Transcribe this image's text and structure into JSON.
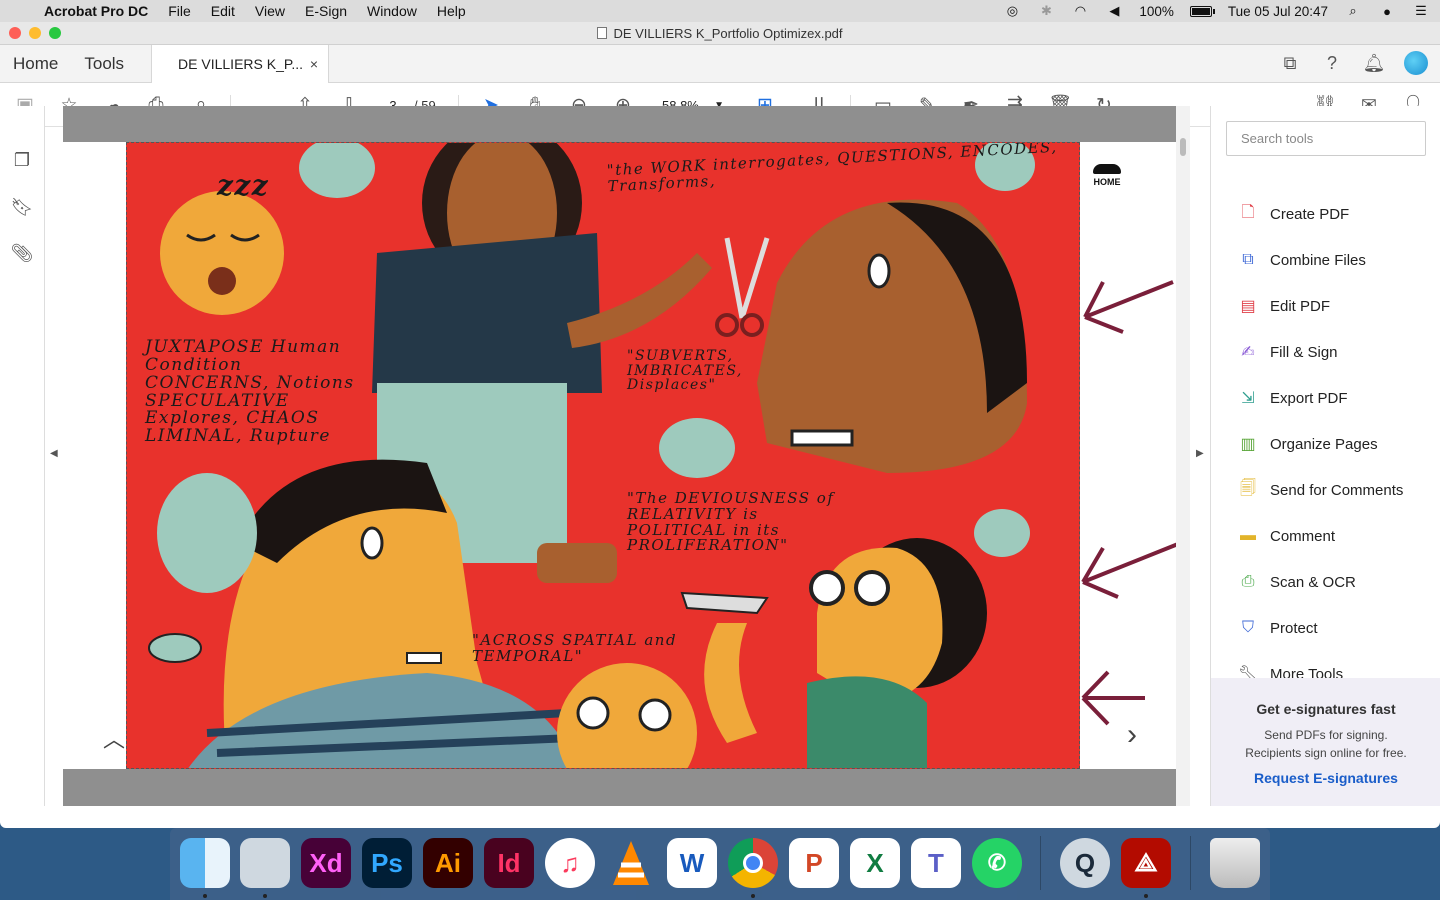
{
  "menubar": {
    "app": "Acrobat Pro DC",
    "items": [
      "File",
      "Edit",
      "View",
      "E-Sign",
      "Window",
      "Help"
    ],
    "battery": "100%",
    "clock": "Tue 05 Jul  20:47"
  },
  "window": {
    "title": "DE VILLIERS K_Portfolio Optimizex.pdf"
  },
  "tabs": {
    "home": "Home",
    "tools": "Tools",
    "doc": "DE VILLIERS K_P...",
    "close": "×"
  },
  "toolbar": {
    "page_current": "3",
    "page_total": "/ 59",
    "zoom": "58,8%"
  },
  "artwork": {
    "quote1": "\"the WORK interrogates, QUESTIONS, ENCODES, Transforms,",
    "quote2": "JUXTAPOSE Human Condition CONCERNS, Notions SPECULATIVE Explores, CHAOS LIMINAL, Rupture",
    "quote3": "\"SUBVERTS, IMBRICATES, Displaces\"",
    "quote4": "\"The DEVIOUSNESS of RELATIVITY is POLITICAL in its PROLIFERATION\"",
    "quote5": "\"ACROSS SPATIAL and TEMPORAL\"",
    "sleep": "zzz",
    "home_label": "HOME"
  },
  "tools_panel": {
    "search_placeholder": "Search tools",
    "items": [
      {
        "label": "Create PDF",
        "color": "#e0424b"
      },
      {
        "label": "Combine Files",
        "color": "#3f69d6"
      },
      {
        "label": "Edit PDF",
        "color": "#e0424b"
      },
      {
        "label": "Fill & Sign",
        "color": "#8a5bd6"
      },
      {
        "label": "Export PDF",
        "color": "#2f9e8f"
      },
      {
        "label": "Organize Pages",
        "color": "#5aa63a"
      },
      {
        "label": "Send for Comments",
        "color": "#e2b42a"
      },
      {
        "label": "Comment",
        "color": "#e2b42a"
      },
      {
        "label": "Scan & OCR",
        "color": "#4aa84a"
      },
      {
        "label": "Protect",
        "color": "#3f69d6"
      },
      {
        "label": "More Tools",
        "color": "#555555"
      }
    ],
    "promo": {
      "heading": "Get e-signatures fast",
      "line1": "Send PDFs for signing.",
      "line2": "Recipients sign online for free.",
      "link": "Request E-signatures"
    }
  },
  "dock": {
    "apps": [
      {
        "name": "Finder",
        "label": ""
      },
      {
        "name": "Preview",
        "label": ""
      },
      {
        "name": "Adobe XD",
        "label": "Xd"
      },
      {
        "name": "Photoshop",
        "label": "Ps"
      },
      {
        "name": "Illustrator",
        "label": "Ai"
      },
      {
        "name": "InDesign",
        "label": "Id"
      },
      {
        "name": "Music",
        "label": "♫"
      },
      {
        "name": "VLC",
        "label": ""
      },
      {
        "name": "Word",
        "label": "W"
      },
      {
        "name": "Chrome",
        "label": ""
      },
      {
        "name": "PowerPoint",
        "label": "P"
      },
      {
        "name": "Excel",
        "label": "X"
      },
      {
        "name": "Teams",
        "label": "T"
      },
      {
        "name": "WhatsApp",
        "label": ""
      },
      {
        "name": "QuickTime",
        "label": "Q"
      },
      {
        "name": "Acrobat",
        "label": ""
      },
      {
        "name": "Trash",
        "label": ""
      }
    ]
  }
}
